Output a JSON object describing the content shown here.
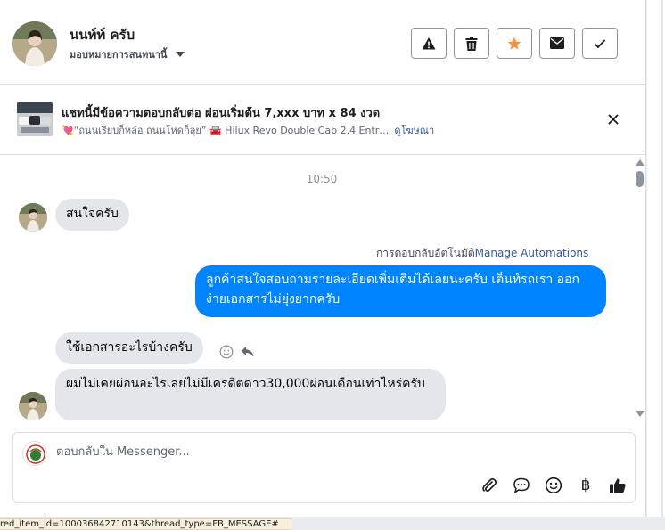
{
  "header": {
    "contact_name": "นนท์ท์ ครับ",
    "assign_label": "มอบหมายการสนทนานี้",
    "actions": [
      "mark-spam",
      "delete",
      "star",
      "mark-unread",
      "done"
    ]
  },
  "ad": {
    "title": "แชทนี้มีข้อความตอบกลับต่อ ผ่อนเริ่มต้น 7,xxx บาท x 84 งวด",
    "subtitle": "💘“ถนนเรียบก็หล่อ ถนนโหดก็ลุย” 🚘 Hilux Revo Double Cab 2.4 Entr…",
    "link": "ดูโฆษณา"
  },
  "thread": {
    "timestamp": "10:50",
    "messages": [
      {
        "direction": "in",
        "text": "สนใจครับ"
      },
      {
        "direction": "out",
        "text": "ลูกค้าสนใจสอบถามรายละเอียดเพิ่มเติมได้เลยนะครับ เต็นท์รถเรา ออกง่ายเอกสารไม่ยุ่งยากครับ"
      },
      {
        "direction": "in",
        "text": "ใช้เอกสารอะไรบ้างครับ"
      },
      {
        "direction": "in",
        "text": "ผมไม่เคยผ่อนอะไรเลยไม่มีเครดิตดาว30,000ผ่อนเดือนเท่าไหร่ครับ"
      }
    ],
    "automation_label": "การตอบกลับอัตโนมัติ",
    "automation_link": "Manage Automations"
  },
  "composer": {
    "placeholder": "ตอบกลับใน Messenger...",
    "tools": [
      "attachment-icon",
      "saved-reply-icon",
      "emoji-icon",
      "baht-icon",
      "like-icon"
    ]
  },
  "statusbar": {
    "text": "red_item_id=100036842710143&thread_type=FB_MESSAGE#"
  },
  "colors": {
    "outgoing_bubble": "#0084ff",
    "incoming_bubble": "#e4e6eb",
    "star": "#f7923b",
    "link": "#385898"
  }
}
